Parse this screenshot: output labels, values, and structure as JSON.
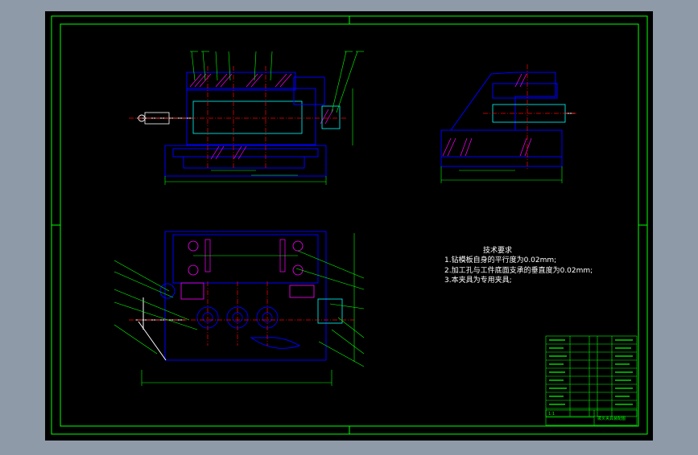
{
  "colors": {
    "background_frame": "#8e9aa8",
    "canvas": "#000000",
    "border": "#00ff00",
    "part_outline": "#0000ff",
    "centerline": "#ff0000",
    "dimension": "#00ff00",
    "hatch": "#ff00ff",
    "text": "#ffffff",
    "detail": "#00ffff"
  },
  "technical_requirements": {
    "title": "技术要求",
    "items": [
      "1.钻模板自身的平行度为0.02mm;",
      "2.加工孔与工件底面支承的垂直度为0.02mm;",
      "3.本夹具为专用夹具;"
    ]
  },
  "title_block": {
    "scale_text": "1:1",
    "drawing_title": "拨叉夹具装配图"
  },
  "views": [
    "front-view",
    "side-view",
    "top-view",
    "parts-list",
    "title-block"
  ]
}
